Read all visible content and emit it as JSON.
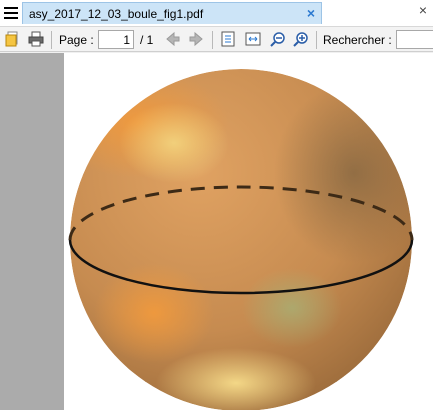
{
  "window": {
    "tab_title": "asy_2017_12_03_boule_fig1.pdf"
  },
  "icons": {
    "menu": "hamburger-menu-icon",
    "tab_close": "close-icon",
    "window_close": "close-icon",
    "open": "open-file-icon",
    "print": "printer-icon",
    "prev_page": "arrow-left-icon",
    "next_page": "arrow-right-icon",
    "fit_page": "fit-page-icon",
    "fit_width": "fit-width-icon",
    "zoom_out": "zoom-out-icon",
    "zoom_in": "zoom-in-icon"
  },
  "toolbar": {
    "page_label": "Page :",
    "current_page": "1",
    "total_pages": "/ 1",
    "search_label": "Rechercher :",
    "search_value": ""
  },
  "colors": {
    "tab_background": "#cce4f7",
    "tab_close": "#2b79d0",
    "viewer_background": "#ababab",
    "sphere_base": "#c98f52"
  }
}
